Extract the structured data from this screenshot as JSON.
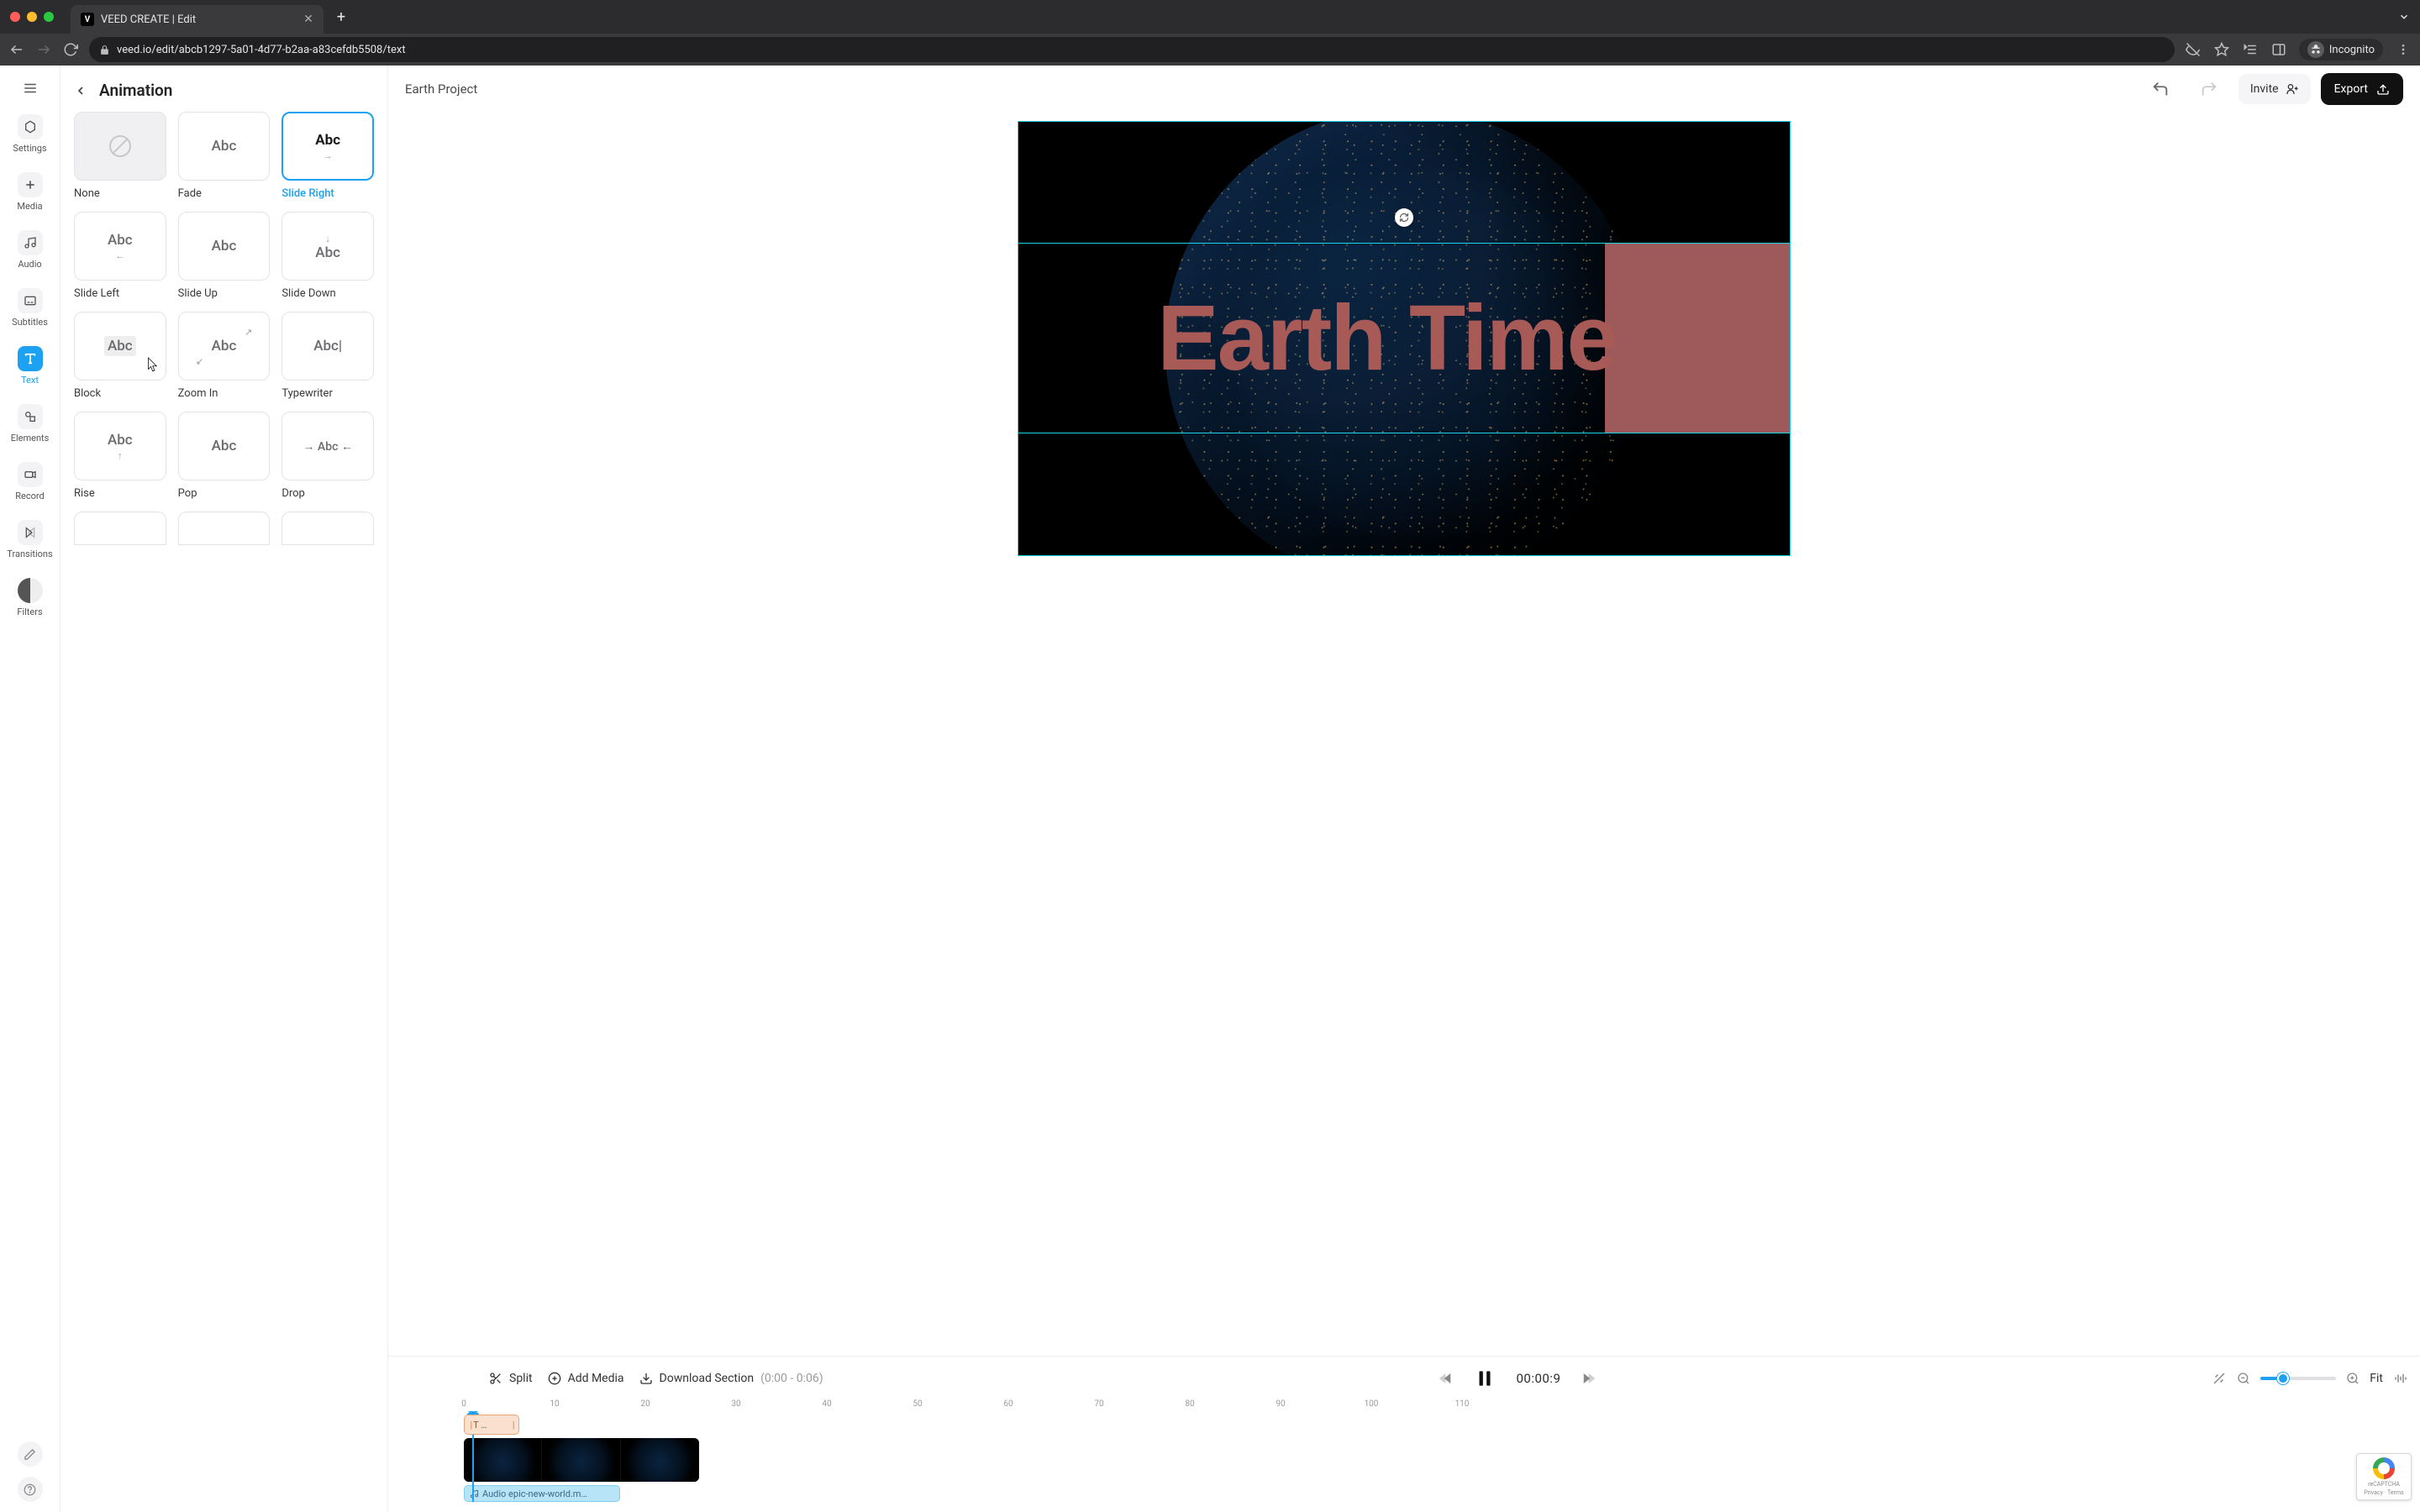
{
  "browser": {
    "tab_title": "VEED CREATE | Edit",
    "tab_favicon": "V",
    "url": "veed.io/edit/abcb1297-5a01-4d77-b2aa-a83cefdb5508/text",
    "incognito_label": "Incognito"
  },
  "rail": {
    "items": [
      {
        "id": "settings",
        "label": "Settings"
      },
      {
        "id": "media",
        "label": "Media"
      },
      {
        "id": "audio",
        "label": "Audio"
      },
      {
        "id": "subtitles",
        "label": "Subtitles"
      },
      {
        "id": "text",
        "label": "Text"
      },
      {
        "id": "elements",
        "label": "Elements"
      },
      {
        "id": "record",
        "label": "Record"
      },
      {
        "id": "transitions",
        "label": "Transitions"
      },
      {
        "id": "filters",
        "label": "Filters"
      }
    ]
  },
  "panel": {
    "title": "Animation",
    "animations": [
      {
        "id": "none",
        "label": "None",
        "sample": ""
      },
      {
        "id": "fade",
        "label": "Fade",
        "sample": "Abc"
      },
      {
        "id": "slide-right",
        "label": "Slide Right",
        "sample": "Abc",
        "arrow": "→"
      },
      {
        "id": "slide-left",
        "label": "Slide Left",
        "sample": "Abc",
        "arrow": "←"
      },
      {
        "id": "slide-up",
        "label": "Slide Up",
        "sample": "Abc",
        "arrow": "↑"
      },
      {
        "id": "slide-down",
        "label": "Slide Down",
        "sample": "Abc",
        "arrow": "↓"
      },
      {
        "id": "block",
        "label": "Block",
        "sample": "Abc"
      },
      {
        "id": "zoom-in",
        "label": "Zoom In",
        "sample": "Abc",
        "arrow": "↗"
      },
      {
        "id": "typewriter",
        "label": "Typewriter",
        "sample": "Abc|"
      },
      {
        "id": "rise",
        "label": "Rise",
        "sample": "Abc",
        "arrow": "↑"
      },
      {
        "id": "pop",
        "label": "Pop",
        "sample": "Abc"
      },
      {
        "id": "drop",
        "label": "Drop",
        "sample": "→ Abc ←"
      }
    ],
    "selected": "slide-right"
  },
  "topbar": {
    "project_name": "Earth Project",
    "invite_label": "Invite",
    "export_label": "Export"
  },
  "canvas": {
    "text": "Earth Time"
  },
  "timeline": {
    "split_label": "Split",
    "add_media_label": "Add Media",
    "download_label": "Download Section",
    "download_range": "(0:00 - 0:06)",
    "timecode": "00:00:9",
    "fit_label": "Fit",
    "ruler_marks": [
      "0",
      "10",
      "20",
      "30",
      "40",
      "50",
      "60",
      "70",
      "80",
      "90",
      "100",
      "110"
    ],
    "text_clip_label": "T …",
    "audio_clip_label": "Audio epic-new-world.m…"
  },
  "recaptcha": {
    "line1": "reCAPTCHA",
    "line2": "Privacy · Terms"
  }
}
